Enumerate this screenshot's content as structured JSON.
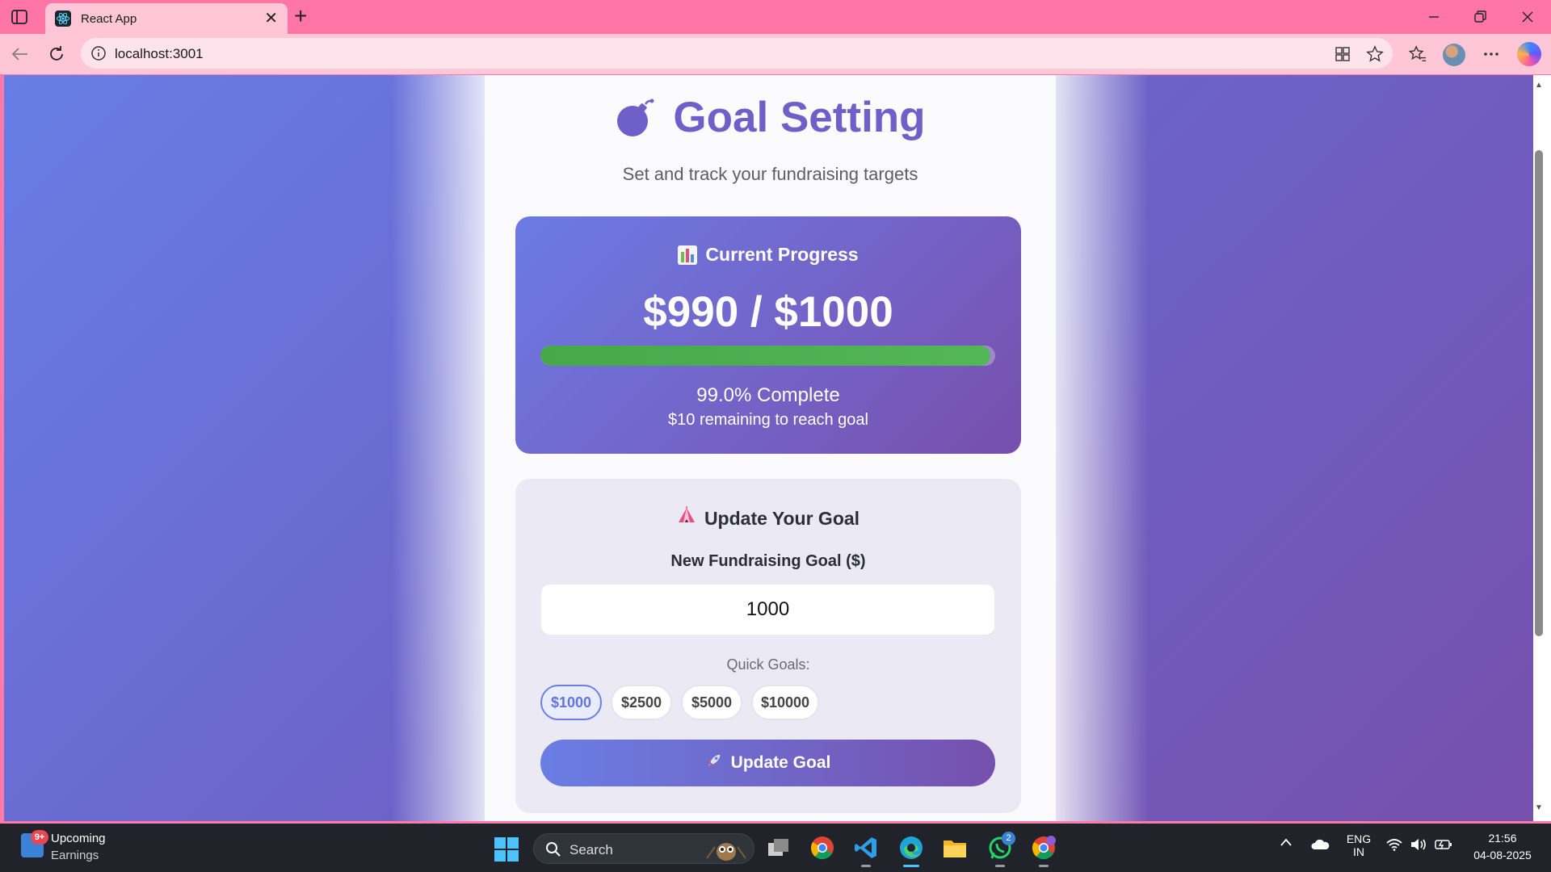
{
  "browser": {
    "tab_title": "React App",
    "url": "localhost:3001"
  },
  "page": {
    "title": "Goal Setting",
    "subtitle": "Set and track your fundraising targets",
    "progress": {
      "heading": "Current Progress",
      "amount": "$990 / $1000",
      "fill_fraction": 0.99,
      "percent_text": "99.0% Complete",
      "remaining_text": "$10 remaining to reach goal"
    },
    "update": {
      "heading": "Update Your Goal",
      "field_label": "New Fundraising Goal ($)",
      "field_value": "1000",
      "quick_label": "Quick Goals:",
      "quick_goals": [
        "$1000",
        "$2500",
        "$5000",
        "$10000"
      ],
      "active_quick_goal_index": 0,
      "button_label": "Update Goal"
    }
  },
  "taskbar": {
    "widget_badge": "9+",
    "widget_title": "Upcoming",
    "widget_subtitle": "Earnings",
    "search_placeholder": "Search",
    "whatsapp_badge": "2",
    "lang_top": "ENG",
    "lang_bottom": "IN",
    "time": "21:56",
    "date": "04-08-2025"
  },
  "colors": {
    "titlebar": "#ff76a6",
    "accent": "#6f60c9",
    "progress_fill": "#4caf50",
    "gradient_start": "#677ee5",
    "gradient_end": "#7650ad"
  }
}
